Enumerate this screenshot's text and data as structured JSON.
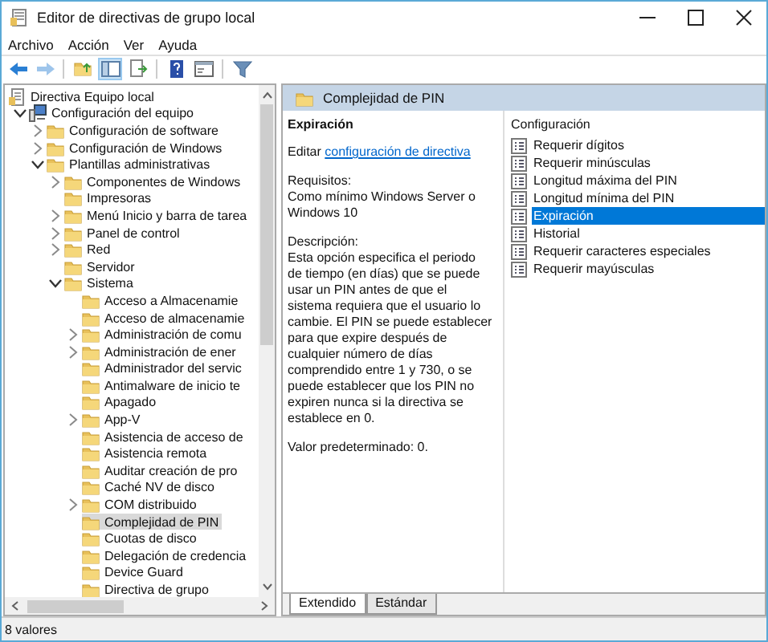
{
  "window": {
    "title": "Editor de directivas de grupo local"
  },
  "menu": [
    "Archivo",
    "Acción",
    "Ver",
    "Ayuda"
  ],
  "toolbar": [
    {
      "kind": "back",
      "disabled": false
    },
    {
      "kind": "forward",
      "disabled": true
    },
    {
      "kind": "separator"
    },
    {
      "kind": "up",
      "disabled": false
    },
    {
      "kind": "tree",
      "disabled": false,
      "pressed": true
    },
    {
      "kind": "export",
      "disabled": false
    },
    {
      "kind": "separator"
    },
    {
      "kind": "help",
      "disabled": false
    },
    {
      "kind": "properties",
      "disabled": false
    },
    {
      "kind": "separator"
    },
    {
      "kind": "filter",
      "disabled": false
    }
  ],
  "tree": [
    {
      "label": "Directiva Equipo local",
      "kind": "root",
      "selected": false,
      "children": [
        {
          "label": "Configuración del equipo",
          "kind": "computer",
          "expanded": true,
          "selected": false,
          "children": [
            {
              "label": "Configuración de software",
              "kind": "folder",
              "expanded": false,
              "selected": false
            },
            {
              "label": "Configuración de Windows",
              "kind": "folder",
              "expanded": false,
              "selected": false
            },
            {
              "label": "Plantillas administrativas",
              "kind": "folder",
              "expanded": true,
              "selected": false,
              "children": [
                {
                  "label": "Componentes de Windows",
                  "kind": "folder",
                  "expanded": false,
                  "selected": false
                },
                {
                  "label": "Impresoras",
                  "kind": "folder",
                  "selected": false
                },
                {
                  "label": "Menú Inicio y barra de tarea",
                  "kind": "folder",
                  "expanded": false,
                  "selected": false
                },
                {
                  "label": "Panel de control",
                  "kind": "folder",
                  "expanded": false,
                  "selected": false
                },
                {
                  "label": "Red",
                  "kind": "folder",
                  "expanded": false,
                  "selected": false
                },
                {
                  "label": "Servidor",
                  "kind": "folder",
                  "selected": false
                },
                {
                  "label": "Sistema",
                  "kind": "folder",
                  "expanded": true,
                  "selected": false,
                  "children": [
                    {
                      "label": "Acceso a Almacenamie",
                      "kind": "folder",
                      "selected": false
                    },
                    {
                      "label": "Acceso de almacenamie",
                      "kind": "folder",
                      "selected": false
                    },
                    {
                      "label": "Administración de comu",
                      "kind": "folder",
                      "expanded": false,
                      "selected": false
                    },
                    {
                      "label": "Administración de ener",
                      "kind": "folder",
                      "expanded": false,
                      "selected": false
                    },
                    {
                      "label": "Administrador del servic",
                      "kind": "folder",
                      "selected": false
                    },
                    {
                      "label": "Antimalware de inicio te",
                      "kind": "folder",
                      "selected": false
                    },
                    {
                      "label": "Apagado",
                      "kind": "folder",
                      "selected": false
                    },
                    {
                      "label": "App-V",
                      "kind": "folder",
                      "expanded": false,
                      "selected": false
                    },
                    {
                      "label": "Asistencia de acceso de",
                      "kind": "folder",
                      "selected": false
                    },
                    {
                      "label": "Asistencia remota",
                      "kind": "folder",
                      "selected": false
                    },
                    {
                      "label": "Auditar creación de pro",
                      "kind": "folder",
                      "selected": false
                    },
                    {
                      "label": "Caché NV de disco",
                      "kind": "folder",
                      "selected": false
                    },
                    {
                      "label": "COM distribuido",
                      "kind": "folder",
                      "expanded": false,
                      "selected": false
                    },
                    {
                      "label": "Complejidad de PIN",
                      "kind": "folder",
                      "selected": true
                    },
                    {
                      "label": "Cuotas de disco",
                      "kind": "folder",
                      "selected": false
                    },
                    {
                      "label": "Delegación de credencia",
                      "kind": "folder",
                      "selected": false
                    },
                    {
                      "label": "Device Guard",
                      "kind": "folder",
                      "selected": false
                    },
                    {
                      "label": "Directiva de grupo",
                      "kind": "folder",
                      "selected": false
                    }
                  ]
                }
              ]
            }
          ]
        }
      ]
    }
  ],
  "header": {
    "title": "Complejidad de PIN"
  },
  "description": {
    "title": "Expiración",
    "edit_text": "Editar",
    "edit_link": "configuración de directiva",
    "requirements_label": "Requisitos:",
    "requirements": "Como mínimo Windows Server o Windows 10",
    "description_label": "Descripción:",
    "description": "Esta opción especifica el periodo de tiempo (en días) que se puede usar un PIN antes de que el sistema requiera que el usuario lo cambie. El PIN se puede establecer para que expire después de cualquier número de días comprendido entre 1 y 730, o se puede establecer que los PIN no expiren nunca si la directiva se establece en 0.",
    "default": "Valor predeterminado: 0."
  },
  "list": {
    "column": "Configuración",
    "items": [
      {
        "label": "Requerir dígitos",
        "selected": false
      },
      {
        "label": "Requerir minúsculas",
        "selected": false
      },
      {
        "label": "Longitud máxima del PIN",
        "selected": false
      },
      {
        "label": "Longitud mínima del PIN",
        "selected": false
      },
      {
        "label": "Expiración",
        "selected": true
      },
      {
        "label": "Historial",
        "selected": false
      },
      {
        "label": "Requerir caracteres especiales",
        "selected": false
      },
      {
        "label": "Requerir mayúsculas",
        "selected": false
      }
    ]
  },
  "tabs": [
    {
      "label": "Extendido",
      "selected": true
    },
    {
      "label": "Estándar",
      "selected": false
    }
  ],
  "status_bar": "8 valores"
}
